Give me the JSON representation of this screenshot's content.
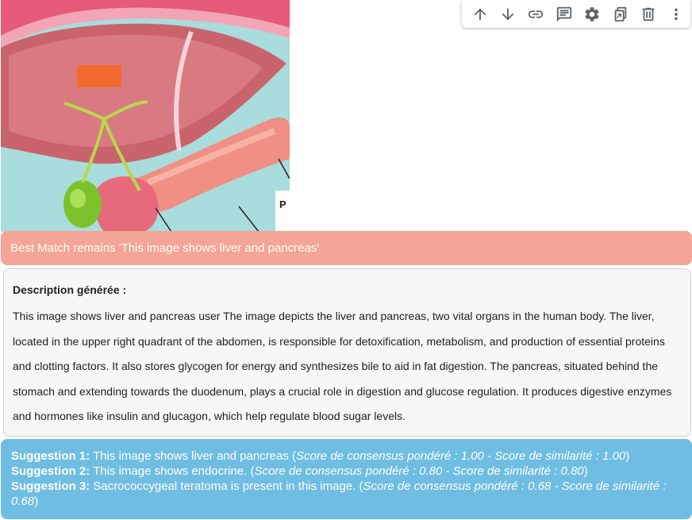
{
  "toolbar": {
    "buttons": [
      {
        "icon": "arrow-up-icon"
      },
      {
        "icon": "arrow-down-icon"
      },
      {
        "icon": "link-icon"
      },
      {
        "icon": "comment-icon"
      },
      {
        "icon": "gear-icon"
      },
      {
        "icon": "copy-icon"
      },
      {
        "icon": "trash-icon"
      },
      {
        "icon": "more-vert-icon"
      }
    ]
  },
  "image": {
    "partial_label": "P"
  },
  "best_match": {
    "text": "Best Match remains 'This image shows liver and pancreas'",
    "color": "#f4a595"
  },
  "description": {
    "heading": "Description générée :",
    "body": "This image shows liver and pancreas user The image depicts the liver and pancreas, two vital organs in the human body. The liver, located in the upper right quadrant of the abdomen, is responsible for detoxification, metabolism, and production of essential proteins and clotting factors. It also stores glycogen for energy and synthesizes bile to aid in fat digestion. The pancreas, situated behind the stomach and extending towards the duodenum, plays a crucial role in digestion and glucose regulation. It produces digestive enzymes and hormones like insulin and glucagon, which help regulate blood sugar levels."
  },
  "suggestions": {
    "color": "#6fbde3",
    "items": [
      {
        "label": "Suggestion 1:",
        "text": "This image shows liver and pancreas",
        "open": "(",
        "score": "Score de consensus pondéré : 1.00 - Score de similarité : 1.00",
        "close": ")"
      },
      {
        "label": "Suggestion 2:",
        "text": "This image shows endocrine.",
        "open": "(",
        "score": "Score de consensus pondéré : 0.80 - Score de similarité : 0.80",
        "close": ")"
      },
      {
        "label": "Suggestion 3:",
        "text": "Sacrococcygeal teratoma is present in this image.",
        "open": "(",
        "score": "Score de consensus pondéré : 0.68 - Score de similarité : 0.68",
        "close": ")"
      }
    ]
  }
}
